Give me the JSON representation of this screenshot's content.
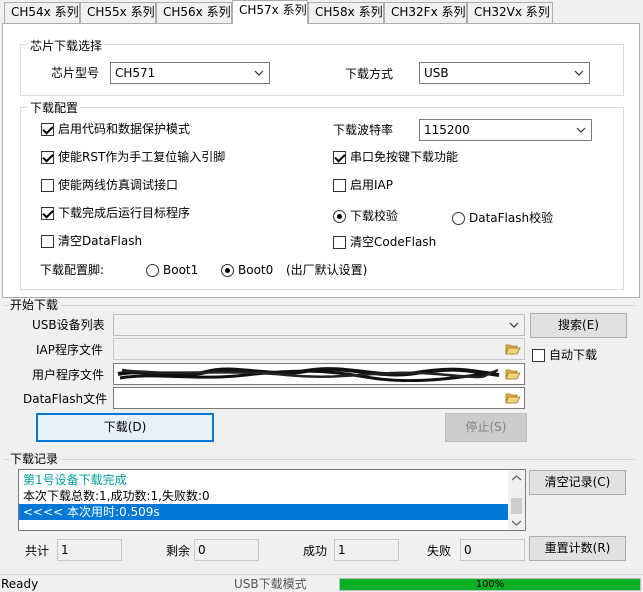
{
  "tabs": [
    "CH54x 系列",
    "CH55x 系列",
    "CH56x 系列",
    "CH57x 系列",
    "CH58x 系列",
    "CH32Fx 系列",
    "CH32Vx 系列"
  ],
  "active_tab": "CH57x 系列",
  "chip_select": {
    "title": "芯片下载选择",
    "chip_model_label": "芯片型号",
    "chip_model_value": "CH571",
    "download_mode_label": "下载方式",
    "download_mode_value": "USB"
  },
  "download_config": {
    "title": "下载配置",
    "options": {
      "code_protect": {
        "label": "启用代码和数据保护模式",
        "checked": true
      },
      "rst_reset": {
        "label": "使能RST作为手工复位输入引脚",
        "checked": true
      },
      "two_wire_debug": {
        "label": "使能两线仿真调试接口",
        "checked": false
      },
      "run_after_download": {
        "label": "下载完成后运行目标程序",
        "checked": true
      },
      "clear_dataflash": {
        "label": "清空DataFlash",
        "checked": false
      },
      "serial_no_key": {
        "label": "串口免按键下载功能",
        "checked": true
      },
      "enable_iap": {
        "label": "启用IAP",
        "checked": false
      },
      "clear_codeflash": {
        "label": "清空CodeFlash",
        "checked": false
      }
    },
    "baud_label": "下载波特率",
    "baud_value": "115200",
    "verify": {
      "download_verify": "下载校验",
      "dataflash_verify": "DataFlash校验",
      "selected": "download_verify"
    },
    "pin_label": "下载配置脚:",
    "pin_boot1": "Boot1",
    "pin_boot0": "Boot0",
    "pin_note": "(出厂默认设置)",
    "pin_selected": "Boot0"
  },
  "start_download": {
    "title": "开始下载",
    "usb_list_label": "USB设备列表",
    "usb_list_value": "",
    "search_button": "搜索(E)",
    "iap_label": "IAP程序文件",
    "iap_value": "",
    "auto_download": {
      "label": "自动下载",
      "checked": false
    },
    "user_program_label": "用户程序文件",
    "user_program_value": "",
    "dataflash_label": "DataFlash文件",
    "dataflash_value": "",
    "download_button": "下载(D)",
    "stop_button": "停止(S)"
  },
  "log": {
    "title": "下载记录",
    "lines": [
      "第1号设备下载完成",
      "本次下载总数:1,成功数:1,失败数:0",
      "<<<< 本次用时:0.509s"
    ],
    "clear_button": "清空记录(C)"
  },
  "counters": {
    "total_label": "共计",
    "total_value": "1",
    "remaining_label": "剩余",
    "remaining_value": "0",
    "success_label": "成功",
    "success_value": "1",
    "fail_label": "失败",
    "fail_value": "0",
    "reset_button": "重置计数(R)"
  },
  "status": {
    "text": "Ready",
    "mode": "USB下载模式",
    "progress_text": "100%",
    "progress_fraction": 1.0
  },
  "colors": {
    "accent": "#0078d7",
    "log_highlight": "#0078d7",
    "log_teal": "#00a0a0",
    "progress": "#06b025"
  },
  "icons": {
    "combo_arrow": "chevron-down-icon",
    "browse": "folder-open-icon"
  }
}
